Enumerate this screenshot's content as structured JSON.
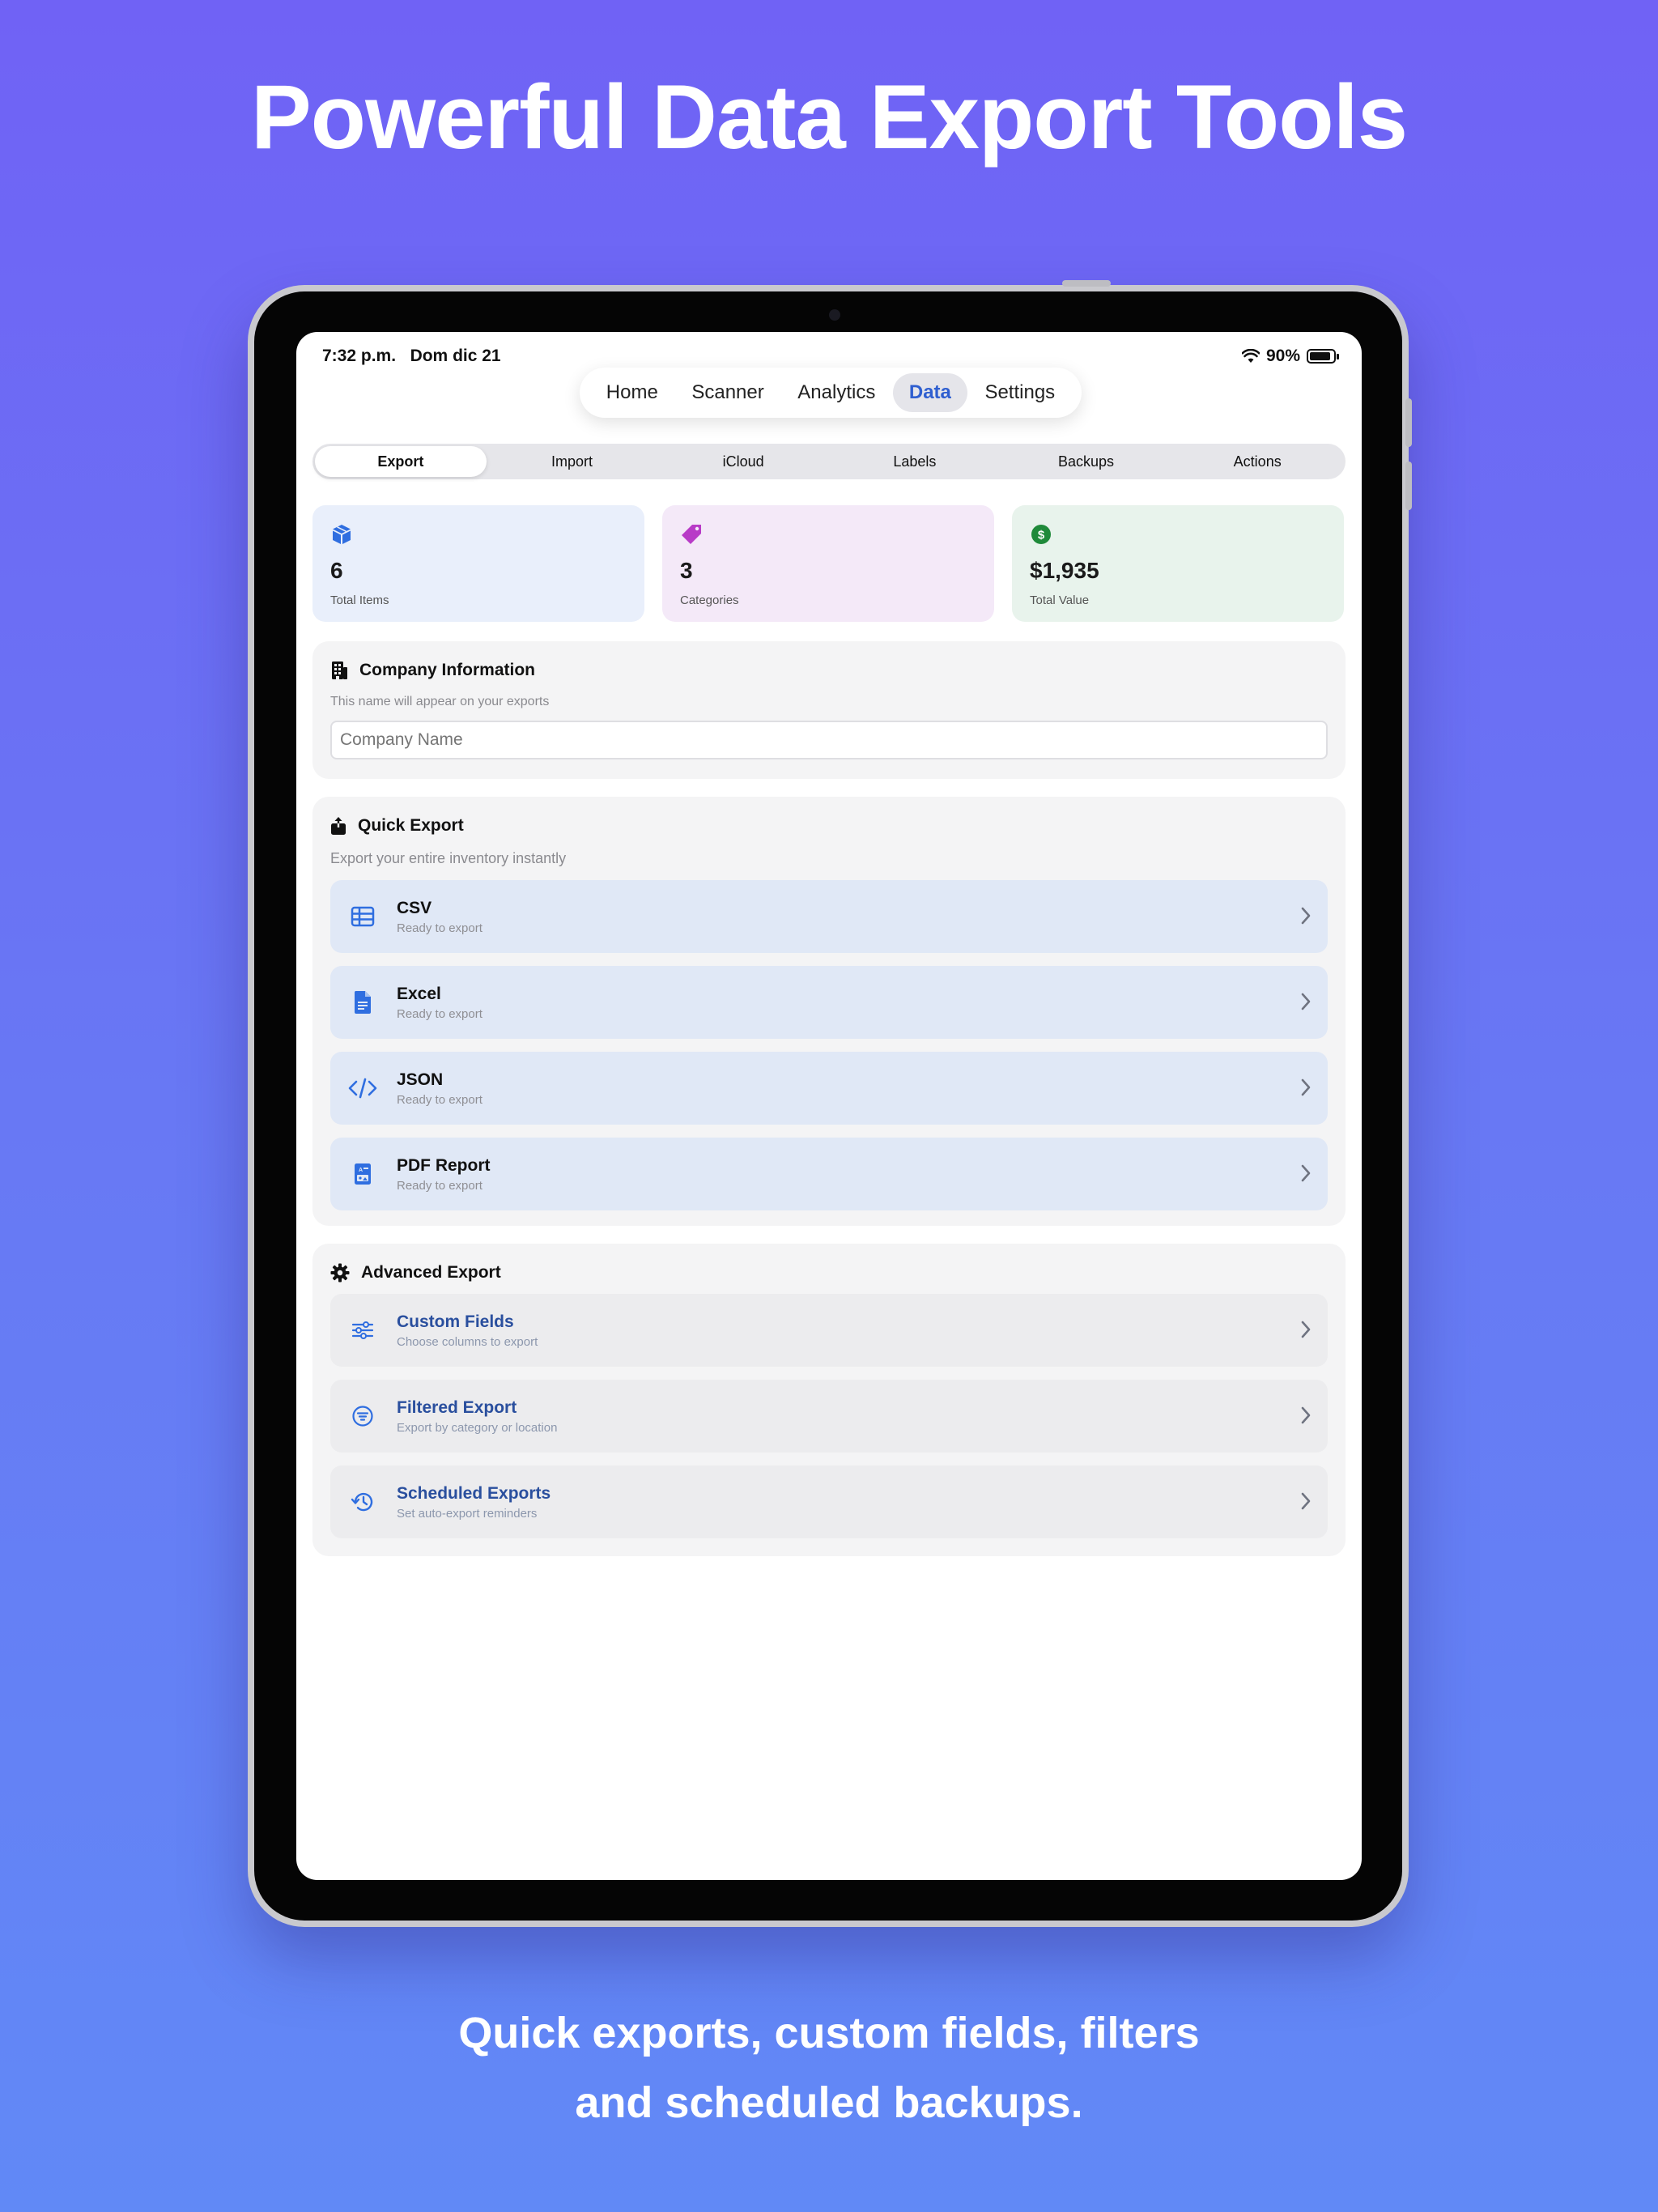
{
  "headline": "Powerful Data Export Tools",
  "subline": [
    "Quick exports, custom fields, filters",
    "and scheduled backups."
  ],
  "status_bar": {
    "time": "7:32 p.m.",
    "date": "Dom dic 21",
    "battery": "90%"
  },
  "top_nav": {
    "items": [
      "Home",
      "Scanner",
      "Analytics",
      "Data",
      "Settings"
    ],
    "active": "Data"
  },
  "segments": {
    "items": [
      "Export",
      "Import",
      "iCloud",
      "Labels",
      "Backups",
      "Actions"
    ],
    "active": "Export"
  },
  "stats": [
    {
      "value": "6",
      "label": "Total Items",
      "icon": "cube-icon",
      "color": "#2f6ee0"
    },
    {
      "value": "3",
      "label": "Categories",
      "icon": "tag-icon",
      "color": "#b83bc7"
    },
    {
      "value": "$1,935",
      "label": "Total Value",
      "icon": "dollar-circle-icon",
      "color": "#1f8a3a"
    }
  ],
  "company": {
    "title": "Company Information",
    "subtitle": "This name will appear on your exports",
    "placeholder": "Company Name"
  },
  "quick_export": {
    "title": "Quick Export",
    "subtitle": "Export your entire inventory instantly",
    "items": [
      {
        "title": "CSV",
        "subtitle": "Ready to export",
        "icon": "table-icon"
      },
      {
        "title": "Excel",
        "subtitle": "Ready to export",
        "icon": "document-icon"
      },
      {
        "title": "JSON",
        "subtitle": "Ready to export",
        "icon": "code-icon"
      },
      {
        "title": "PDF Report",
        "subtitle": "Ready to export",
        "icon": "report-icon"
      }
    ]
  },
  "advanced_export": {
    "title": "Advanced Export",
    "items": [
      {
        "title": "Custom Fields",
        "subtitle": "Choose columns to export",
        "icon": "sliders-icon"
      },
      {
        "title": "Filtered Export",
        "subtitle": "Export by category or location",
        "icon": "filter-icon"
      },
      {
        "title": "Scheduled Exports",
        "subtitle": "Set auto-export reminders",
        "icon": "history-icon"
      }
    ]
  },
  "colors": {
    "accent": "#2f5fd0",
    "icon_blue": "#2f6ee0",
    "background_top": "#7062f5",
    "background_bottom": "#6189f6"
  }
}
